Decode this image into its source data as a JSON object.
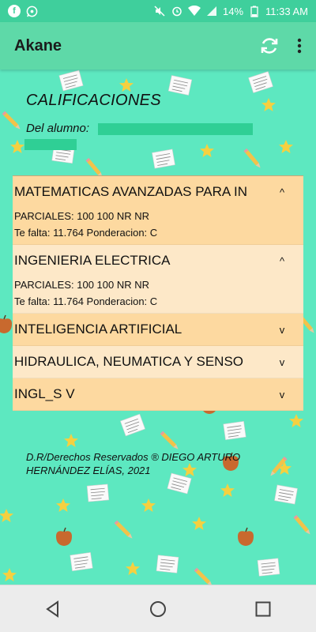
{
  "status_bar": {
    "time": "11:33 AM",
    "battery": "14%",
    "icons": [
      "facebook-icon",
      "whatsapp-icon",
      "mute-icon",
      "alarm-icon",
      "wifi-icon",
      "signal-icon",
      "battery-icon"
    ]
  },
  "app_bar": {
    "title": "Akane",
    "actions": [
      "refresh-icon",
      "more-vert-icon"
    ]
  },
  "page": {
    "heading": "CALIFICACIONES",
    "student_label": "Del alumno:"
  },
  "courses": [
    {
      "name": "MATEMATICAS AVANZADAS PARA IN",
      "chevron": "^",
      "expanded": true,
      "parciales": "PARCIALES: 100  100  NR  NR",
      "falta": "Te falta: 11.764 Ponderacion: C"
    },
    {
      "name": "INGENIERIA ELECTRICA",
      "chevron": "^",
      "expanded": true,
      "parciales": "PARCIALES: 100  100  NR  NR",
      "falta": "Te falta: 11.764 Ponderacion: C"
    },
    {
      "name": "INTELIGENCIA ARTIFICIAL",
      "chevron": "v",
      "expanded": false
    },
    {
      "name": "HIDRAULICA, NEUMATICA Y SENSO",
      "chevron": "v",
      "expanded": false
    },
    {
      "name": "INGL_S V",
      "chevron": "v",
      "expanded": false
    }
  ],
  "footer": {
    "copyright": "D.R/Derechos Reservados ® DIEGO ARTURO HERNÁNDEZ ELÍAS, 2021"
  },
  "nav_bar": {
    "buttons": [
      "back-icon",
      "home-icon",
      "recents-icon"
    ]
  },
  "colors": {
    "background": "#5de8c0",
    "app_bar": "#5ed9a8",
    "status_bar": "#3fcf9c",
    "card_dark": "#fdd9a0",
    "card_light": "#fde8c8"
  }
}
